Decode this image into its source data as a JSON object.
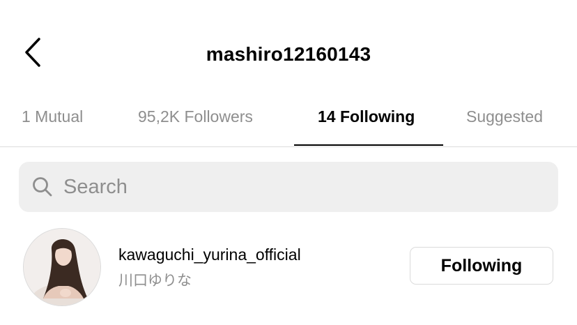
{
  "header": {
    "title": "mashiro12160143",
    "back_icon": "chevron-left-icon"
  },
  "tabs": [
    {
      "label": "1 Mutual",
      "active": false
    },
    {
      "label": "95,2K Followers",
      "active": false
    },
    {
      "label": "14 Following",
      "active": true
    },
    {
      "label": "Suggested",
      "active": false
    }
  ],
  "search": {
    "placeholder": "Search",
    "value": "",
    "icon": "search-icon"
  },
  "users": [
    {
      "username": "kawaguchi_yurina_official",
      "full_name": "川口ゆりな",
      "button_label": "Following"
    }
  ],
  "colors": {
    "secondary_text": "#8e8e8e",
    "divider": "#dbdbdb",
    "search_bg": "#efefef"
  }
}
